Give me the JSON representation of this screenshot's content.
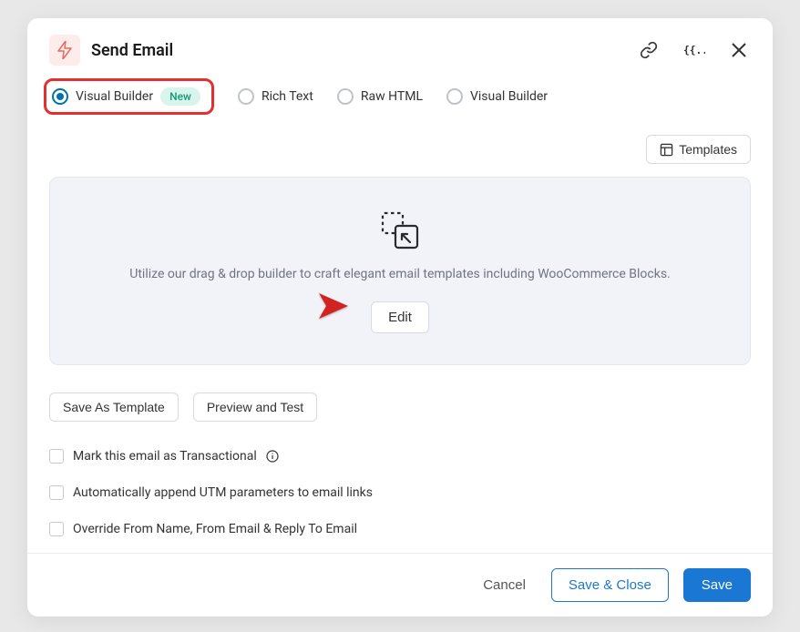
{
  "header": {
    "title": "Send Email"
  },
  "tabs": {
    "visual_builder": {
      "label": "Visual Builder",
      "badge": "New",
      "selected": true
    },
    "rich_text": {
      "label": "Rich Text",
      "selected": false
    },
    "raw_html": {
      "label": "Raw HTML",
      "selected": false
    },
    "visual_builder_2": {
      "label": "Visual Builder",
      "selected": false
    }
  },
  "templates_button": "Templates",
  "builder": {
    "description": "Utilize our drag & drop builder to craft elegant email templates including WooCommerce Blocks.",
    "edit_label": "Edit"
  },
  "actions": {
    "save_template": "Save As Template",
    "preview_test": "Preview and Test"
  },
  "checkboxes": {
    "transactional": "Mark this email as Transactional",
    "utm": "Automatically append UTM parameters to email links",
    "override_from": "Override From Name, From Email & Reply To Email"
  },
  "footer": {
    "cancel": "Cancel",
    "save_close": "Save & Close",
    "save": "Save"
  }
}
